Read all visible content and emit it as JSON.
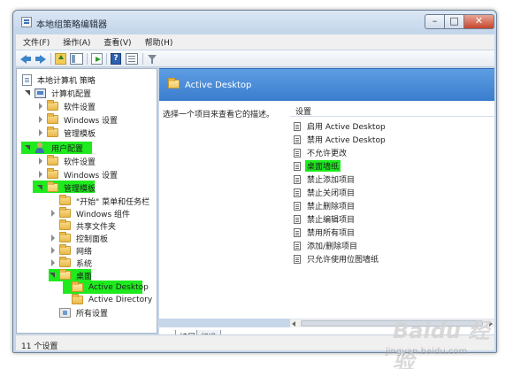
{
  "window": {
    "title": "本地组策略编辑器",
    "caption_min": "–",
    "caption_max": "□",
    "caption_close": "✕"
  },
  "menu": [
    "文件(F)",
    "操作(A)",
    "查看(V)",
    "帮助(H)"
  ],
  "toolbar": {
    "icons": [
      "back-arrow-icon",
      "forward-arrow-icon",
      "up-folder-icon",
      "show-tree-icon",
      "export-list-icon",
      "help-icon",
      "view-icon",
      "filter-icon"
    ],
    "help_label": "?"
  },
  "tree": {
    "root": "本地计算机 策略",
    "computer_config": "计算机配置",
    "computer_children": [
      "软件设置",
      "Windows 设置",
      "管理模板"
    ],
    "user_config": "用户配置",
    "user_children": [
      "软件设置",
      "Windows 设置",
      "管理模板"
    ],
    "admin_templates_children": [
      "\"开始\" 菜单和任务栏",
      "Windows 组件",
      "共享文件夹",
      "控制面板",
      "网络",
      "系统",
      "桌面"
    ],
    "desktop_children": [
      "Active Desktop",
      "Active Directory"
    ],
    "all_settings": "所有设置",
    "highlight_color": "#1eea1e"
  },
  "right_pane": {
    "header_title": "Active Desktop",
    "description_prompt": "选择一个项目来查看它的描述。",
    "settings_header": "设置",
    "settings": [
      "启用 Active Desktop",
      "禁用 Active Desktop",
      "不允许更改",
      "桌面墙纸",
      "禁止添加项目",
      "禁止关闭项目",
      "禁止删除项目",
      "禁止编辑项目",
      "禁用所有项目",
      "添加/删除项目",
      "只允许使用位图墙纸"
    ],
    "header_color": "#3a7dcd"
  },
  "tabs": [
    "扩展",
    "标准"
  ],
  "status": "11 个设置",
  "watermark": {
    "logo": "Baidu 经验",
    "url": "jingyan.baidu.com"
  }
}
